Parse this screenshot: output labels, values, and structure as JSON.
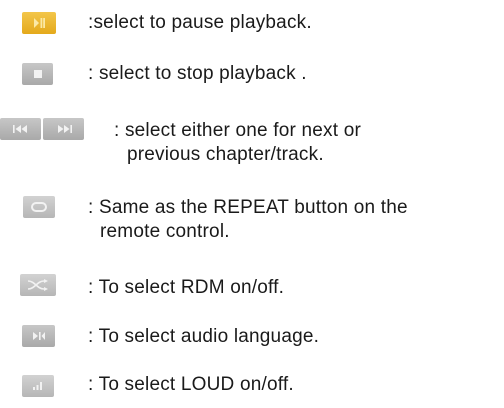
{
  "items": [
    {
      "icon": "play-pause-icon",
      "lines": [
        ":select to pause playback."
      ]
    },
    {
      "icon": "stop-icon",
      "lines": [
        ": select to stop playback ."
      ]
    },
    {
      "icon": "skip-prev-next-icon",
      "lines": [
        ": select either one for next or",
        "previous chapter/track."
      ]
    },
    {
      "icon": "repeat-icon",
      "lines": [
        ": Same as the REPEAT button on the",
        "remote control."
      ]
    },
    {
      "icon": "shuffle-icon",
      "lines": [
        ": To select RDM on/off."
      ]
    },
    {
      "icon": "audio-language-icon",
      "lines": [
        ": To select audio language."
      ]
    },
    {
      "icon": "loudness-icon",
      "lines": [
        ": To select LOUD on/off."
      ]
    }
  ],
  "colors": {
    "accent": "#e8b020",
    "icon_grey": "#b5b5b5",
    "icon_glyph": "#f2f2f2",
    "text": "#1a1a1a"
  }
}
